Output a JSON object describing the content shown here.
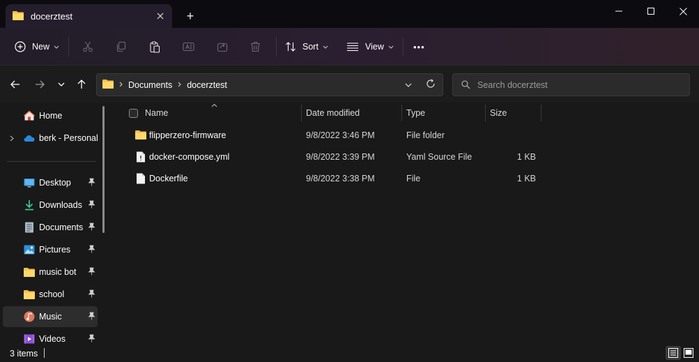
{
  "window": {
    "tab_title": "docerztest",
    "new_tab_symbol": "+"
  },
  "toolbar": {
    "new_label": "New",
    "sort_label": "Sort",
    "view_label": "View",
    "more_label": "•••"
  },
  "address": {
    "crumbs": [
      "Documents",
      "docerztest"
    ],
    "search_placeholder": "Search docerztest"
  },
  "sidebar": {
    "items": [
      {
        "label": "Home",
        "icon": "home-icon"
      },
      {
        "label": "berk - Personal",
        "icon": "onedrive-cloud-icon"
      },
      {
        "label": "Desktop",
        "icon": "desktop-icon",
        "pinned": true
      },
      {
        "label": "Downloads",
        "icon": "download-icon",
        "pinned": true
      },
      {
        "label": "Documents",
        "icon": "documents-icon",
        "pinned": true
      },
      {
        "label": "Pictures",
        "icon": "pictures-icon",
        "pinned": true
      },
      {
        "label": "music bot",
        "icon": "folder-icon",
        "pinned": true
      },
      {
        "label": "school",
        "icon": "folder-icon",
        "pinned": true
      },
      {
        "label": "Music",
        "icon": "music-icon",
        "pinned": true,
        "selected": true
      },
      {
        "label": "Videos",
        "icon": "videos-icon",
        "pinned": true
      }
    ]
  },
  "columns": {
    "name": "Name",
    "date": "Date modified",
    "type": "Type",
    "size": "Size"
  },
  "files": [
    {
      "name": "flipperzero-firmware",
      "date": "9/8/2022 3:46 PM",
      "type": "File folder",
      "size": "",
      "icon": "folder-icon"
    },
    {
      "name": "docker-compose.yml",
      "date": "9/8/2022 3:39 PM",
      "type": "Yaml Source File",
      "size": "1 KB",
      "icon": "yaml-file-icon"
    },
    {
      "name": "Dockerfile",
      "date": "9/8/2022 3:38 PM",
      "type": "File",
      "size": "1 KB",
      "icon": "file-icon"
    }
  ],
  "status": {
    "item_count": "3 items"
  },
  "colors": {
    "folder": "#f4c04e",
    "accent": "#4cc2ff",
    "background": "#191919"
  }
}
